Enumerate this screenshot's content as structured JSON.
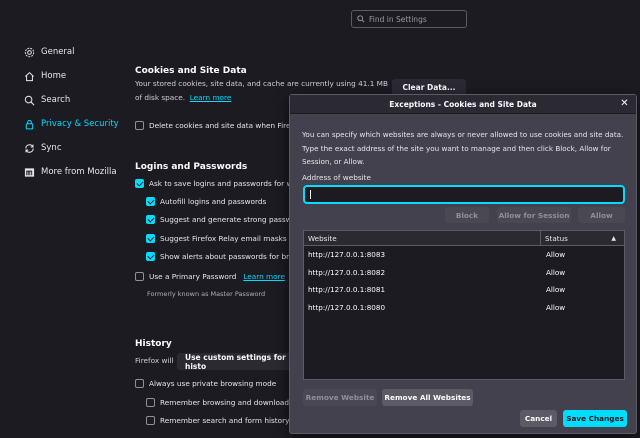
{
  "search": {
    "placeholder": "Find in Settings"
  },
  "sidebar": {
    "items": [
      {
        "label": "General",
        "icon": "gear-icon"
      },
      {
        "label": "Home",
        "icon": "home-icon"
      },
      {
        "label": "Search",
        "icon": "search-icon"
      },
      {
        "label": "Privacy & Security",
        "icon": "lock-icon",
        "active": true
      },
      {
        "label": "Sync",
        "icon": "sync-icon"
      },
      {
        "label": "More from Mozilla",
        "icon": "mozilla-icon"
      }
    ]
  },
  "cookies": {
    "title": "Cookies and Site Data",
    "desc_line1": "Your stored cookies, site data, and cache are currently using 41.1 MB",
    "desc_line2": "of disk space.",
    "learn_more": "Learn more",
    "clear_button": "Clear Data...",
    "delete_on_close": "Delete cookies and site data when Firefox i"
  },
  "logins": {
    "title": "Logins and Passwords",
    "ask_to_save": "Ask to save logins and passwords for webs",
    "autofill": "Autofill logins and passwords",
    "suggest_strong": "Suggest and generate strong password",
    "suggest_relay": "Suggest Firefox Relay email masks to p",
    "show_alerts": "Show alerts about passwords for breac",
    "primary_password": "Use a Primary Password",
    "primary_learn_more": "Learn more",
    "formerly": "Formerly known as Master Password"
  },
  "history": {
    "title": "History",
    "firefox_will": "Firefox will",
    "mode": "Use custom settings for histo",
    "private_mode": "Always use private browsing mode",
    "remember_browsing": "Remember browsing and download hist",
    "remember_search": "Remember search and form history"
  },
  "dialog": {
    "title": "Exceptions - Cookies and Site Data",
    "description": "You can specify which websites are always or never allowed to use cookies and site data. Type the exact address of the site you want to manage and then click Block, Allow for Session, or Allow.",
    "address_label": "Address of website",
    "address_value": "",
    "block": "Block",
    "allow_session": "Allow for Session",
    "allow": "Allow",
    "col_website": "Website",
    "col_status": "Status",
    "rows": [
      {
        "site": "http://127.0.0.1:8083",
        "status": "Allow"
      },
      {
        "site": "http://127.0.0.1:8082",
        "status": "Allow"
      },
      {
        "site": "http://127.0.0.1:8081",
        "status": "Allow"
      },
      {
        "site": "http://127.0.0.1:8080",
        "status": "Allow"
      }
    ],
    "remove_website": "Remove Website",
    "remove_all": "Remove All Websites",
    "cancel": "Cancel",
    "save": "Save Changes"
  },
  "colors": {
    "accent": "#00ddff",
    "background": "#1c1b22",
    "dialog": "#42414d"
  }
}
